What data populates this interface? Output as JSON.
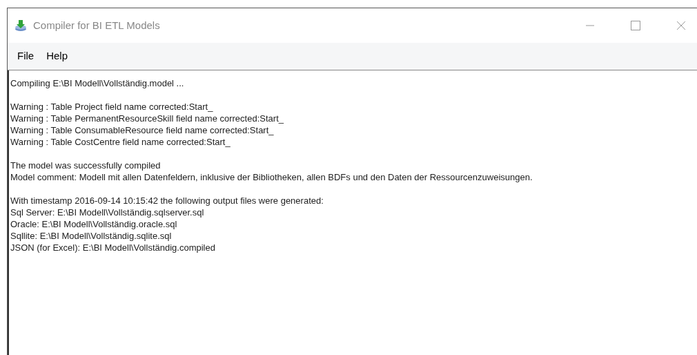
{
  "window": {
    "title": "Compiler for BI ETL Models"
  },
  "menu": [
    {
      "label": "File"
    },
    {
      "label": "Help"
    }
  ],
  "output": [
    [
      "Compiling E:\\BI Modell\\Vollständig.model ..."
    ],
    [
      "Warning : Table Project field name corrected:Start_",
      "Warning : Table PermanentResourceSkill field name corrected:Start_",
      "Warning : Table ConsumableResource field name corrected:Start_",
      "Warning : Table CostCentre field name corrected:Start_"
    ],
    [
      "The model was successfully compiled",
      "Model comment: Modell mit allen Datenfeldern, inklusive der Bibliotheken, allen BDFs und den Daten der Ressourcenzuweisungen."
    ],
    [
      "With timestamp 2016-09-14 10:15:42 the following output files were generated:",
      "Sql Server: E:\\BI Modell\\Vollständig.sqlserver.sql",
      "Oracle: E:\\BI Modell\\Vollständig.oracle.sql",
      "Sqllite: E:\\BI Modell\\Vollständig.sqlite.sql",
      "JSON (for Excel): E:\\BI Modell\\Vollständig.compiled"
    ]
  ]
}
